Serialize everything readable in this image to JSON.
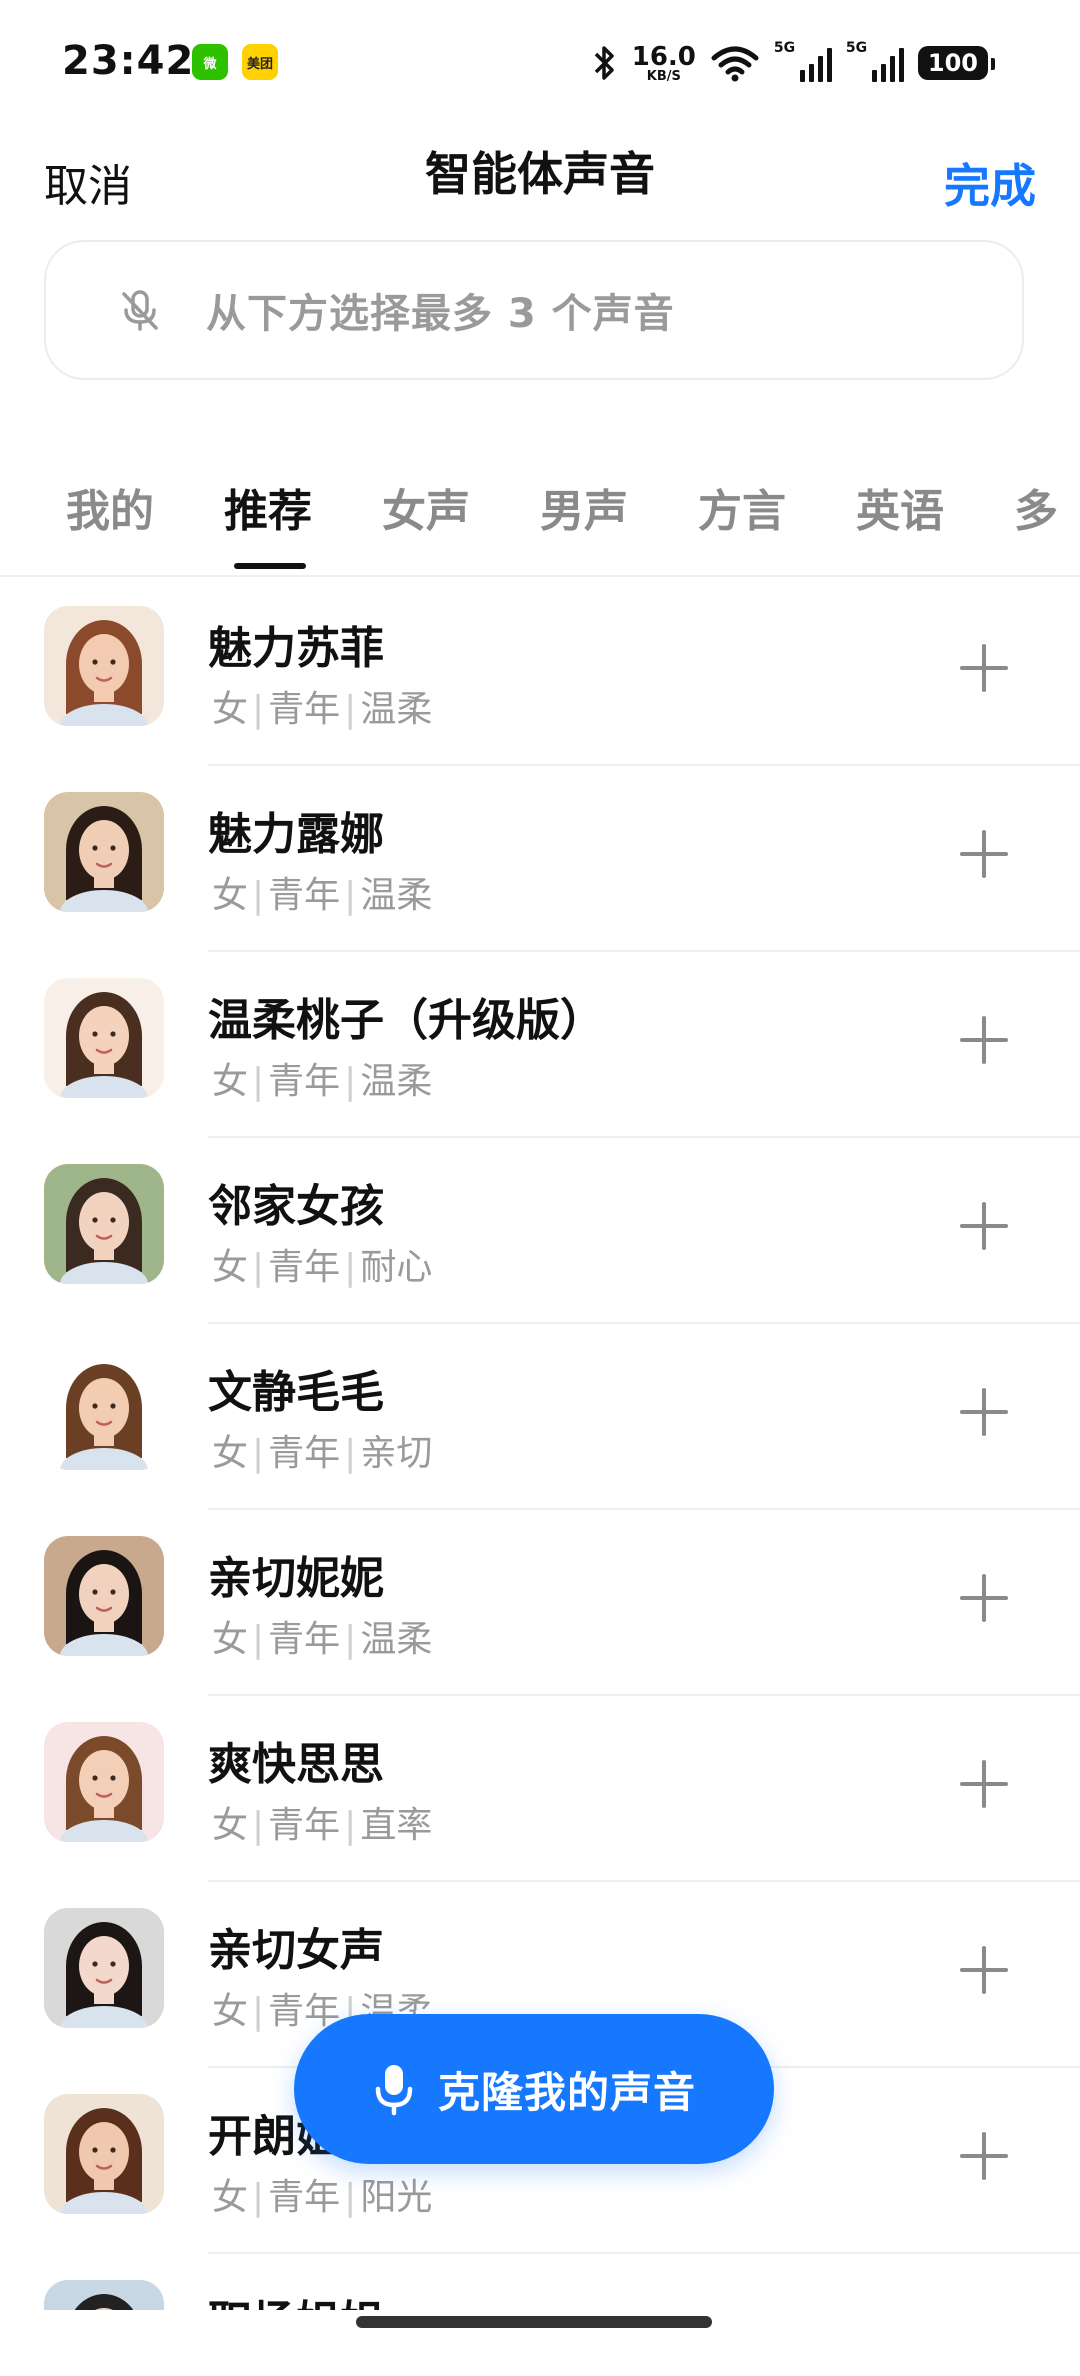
{
  "status_bar": {
    "time": "23:42",
    "badge_wechat": "微",
    "badge_meituan": "美团",
    "speed_value": "16.0",
    "speed_unit": "KB/S",
    "signal_label": "5G",
    "battery": "100"
  },
  "nav": {
    "cancel": "取消",
    "title": "智能体声音",
    "done": "完成"
  },
  "selector": {
    "placeholder": "从下方选择最多 3 个声音"
  },
  "tabs": [
    {
      "label": "我的"
    },
    {
      "label": "推荐",
      "active": true
    },
    {
      "label": "女声"
    },
    {
      "label": "男声"
    },
    {
      "label": "方言"
    },
    {
      "label": "英语"
    },
    {
      "label": "多"
    }
  ],
  "voices": [
    {
      "name": "魅力苏菲",
      "tags": [
        "女",
        "青年",
        "温柔"
      ],
      "hair": "#8b4a2b",
      "skin": "#f2cbb0",
      "bg": "#f3e7dc"
    },
    {
      "name": "魅力露娜",
      "tags": [
        "女",
        "青年",
        "温柔"
      ],
      "hair": "#2b1d16",
      "skin": "#f0cdb5",
      "bg": "#d8c4a6"
    },
    {
      "name": "温柔桃子（升级版）",
      "tags": [
        "女",
        "青年",
        "温柔"
      ],
      "hair": "#4a2e20",
      "skin": "#f5d2bb",
      "bg": "#f7efe8"
    },
    {
      "name": "邻家女孩",
      "tags": [
        "女",
        "青年",
        "耐心"
      ],
      "hair": "#3b2a20",
      "skin": "#f2d3c0",
      "bg": "#9fb58a"
    },
    {
      "name": "文静毛毛",
      "tags": [
        "女",
        "青年",
        "亲切"
      ],
      "hair": "#6a3f24",
      "skin": "#f3cdb2",
      "bg": "#ffffff"
    },
    {
      "name": "亲切妮妮",
      "tags": [
        "女",
        "青年",
        "温柔"
      ],
      "hair": "#1a1412",
      "skin": "#f1d2bf",
      "bg": "#c9a98e"
    },
    {
      "name": "爽快思思",
      "tags": [
        "女",
        "青年",
        "直率"
      ],
      "hair": "#7a4a2a",
      "skin": "#f4cfb7",
      "bg": "#f7e4e4"
    },
    {
      "name": "亲切女声",
      "tags": [
        "女",
        "青年",
        "温柔"
      ],
      "hair": "#1c1614",
      "skin": "#f3d9cb",
      "bg": "#d9d9d9"
    },
    {
      "name": "开朗姐姐",
      "tags": [
        "女",
        "青年",
        "阳光"
      ],
      "hair": "#5a2f1c",
      "skin": "#f0c8ad",
      "bg": "#efe3d6"
    },
    {
      "name": "职场姐姐",
      "tags": [],
      "hair": "#222",
      "skin": "#f0d0bd",
      "bg": "#c8d7e4"
    }
  ],
  "clone_button": {
    "label": "克隆我的声音"
  },
  "colors": {
    "accent": "#1677ff",
    "text_primary": "#111111",
    "text_secondary": "#9a9a9a"
  }
}
